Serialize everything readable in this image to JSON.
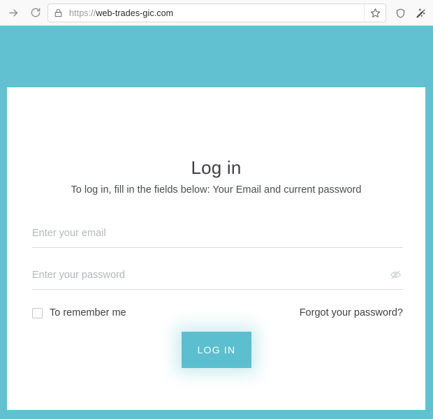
{
  "browser": {
    "forward_icon": "forward-arrow-icon",
    "reload_icon": "reload-icon",
    "lock_icon": "lock-icon",
    "url_scheme": "https://",
    "url_domain": "web-trades-gic.com",
    "url_full": "https://web-trades-gic.com",
    "bookmark_icon": "star-icon",
    "shield_icon": "shield-icon",
    "wand_icon": "magic-wand-icon"
  },
  "page": {
    "background_color": "#62c1d1",
    "card_background": "#ffffff"
  },
  "login": {
    "title": "Log in",
    "subtitle": "To log in, fill in the fields below: Your Email and current password",
    "email": {
      "value": "",
      "placeholder": "Enter your email"
    },
    "password": {
      "value": "",
      "placeholder": "Enter your password",
      "toggle_icon": "eye-slash-icon"
    },
    "remember": {
      "label": "To remember me",
      "checked": false
    },
    "forgot_label": "Forgot your password?",
    "submit_label": "LOG IN",
    "accent_color": "#5bbfcf"
  }
}
